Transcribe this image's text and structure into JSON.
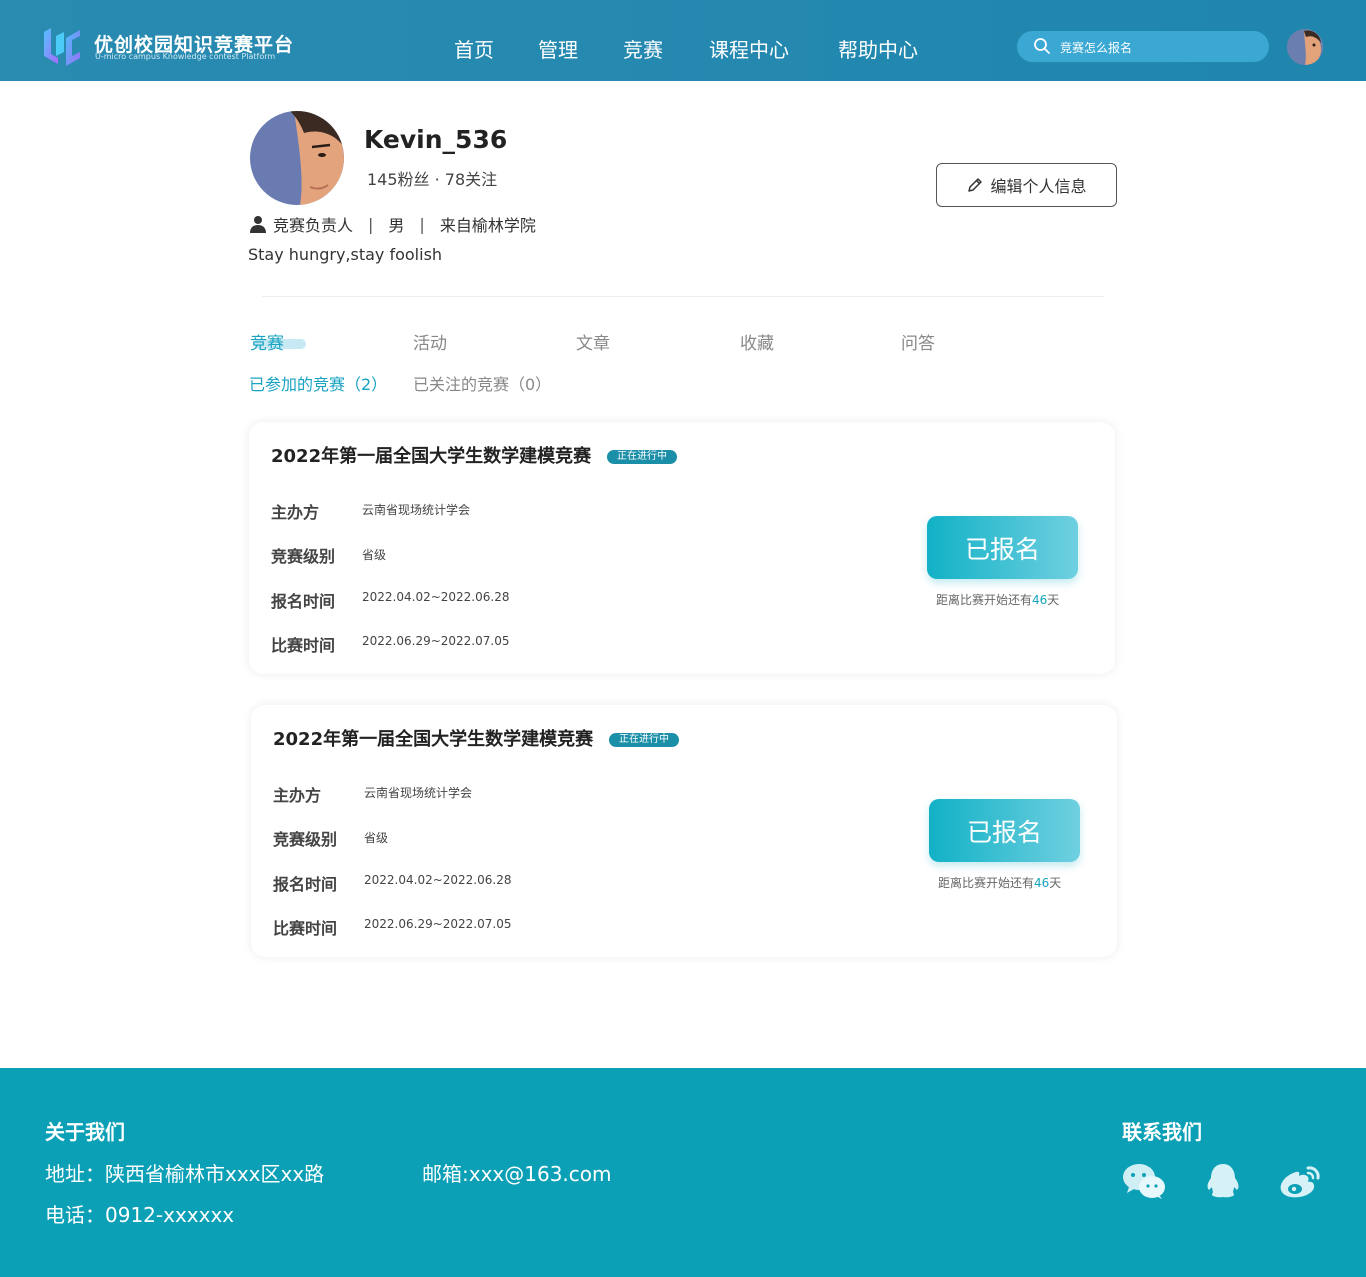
{
  "header": {
    "brand_title": "优创校园知识竞赛平台",
    "brand_subtitle": "U-micro campus Knowledge contest Platform",
    "nav": [
      "首页",
      "管理",
      "竞赛",
      "课程中心",
      "帮助中心"
    ],
    "search_text": "竞赛怎么报名",
    "colors": {
      "bar": "#2a8bb1",
      "search_bg": "#3aa8d3"
    }
  },
  "profile": {
    "username": "Kevin_536",
    "stats": "145粉丝 · 78关注",
    "role": "竞赛负责人",
    "sep": "|",
    "gender": "男",
    "origin": "来自榆林学院",
    "bio": "Stay hungry,stay foolish",
    "edit_label": "编辑个人信息"
  },
  "tabs": [
    "竞赛",
    "活动",
    "文章",
    "收藏",
    "问答"
  ],
  "subtabs": [
    "已参加的竞赛（2）",
    "已关注的竞赛（0）"
  ],
  "competitions": [
    {
      "title": "2022年第一届全国大学生数学建模竞赛",
      "status": "正在进行中",
      "fields": [
        {
          "label": "主办方",
          "value": "云南省现场统计学会"
        },
        {
          "label": "竞赛级别",
          "value": "省级"
        },
        {
          "label": "报名时间",
          "value": "2022.04.02~2022.06.28"
        },
        {
          "label": "比赛时间",
          "value": "2022.06.29~2022.07.05"
        }
      ],
      "button": "已报名",
      "countdown_prefix": "距离比赛开始还有",
      "countdown_days": "46",
      "countdown_suffix": "天"
    },
    {
      "title": "2022年第一届全国大学生数学建模竞赛",
      "status": "正在进行中",
      "fields": [
        {
          "label": "主办方",
          "value": "云南省现场统计学会"
        },
        {
          "label": "竞赛级别",
          "value": "省级"
        },
        {
          "label": "报名时间",
          "value": "2022.04.02~2022.06.28"
        },
        {
          "label": "比赛时间",
          "value": "2022.06.29~2022.07.05"
        }
      ],
      "button": "已报名",
      "countdown_prefix": "距离比赛开始还有",
      "countdown_days": "46",
      "countdown_suffix": "天"
    }
  ],
  "footer": {
    "about": "关于我们",
    "address": "地址：陕西省榆林市xxx区xx路",
    "email": "邮箱:xxx@163.com",
    "phone": "电话：0912-xxxxxx",
    "contact": "联系我们",
    "social_icons": [
      "wechat-icon",
      "qq-icon",
      "weibo-icon"
    ],
    "bg_color": "#0ca0b7"
  }
}
